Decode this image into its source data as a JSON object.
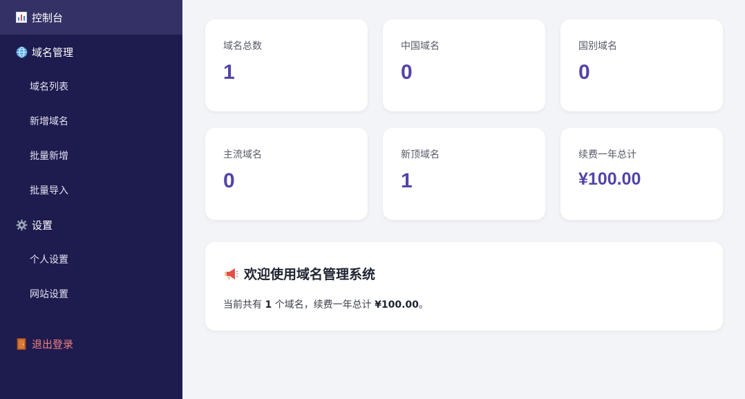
{
  "sidebar": {
    "items": [
      {
        "label": "控制台",
        "icon": "bar-chart-icon",
        "active": true
      },
      {
        "label": "域名管理",
        "icon": "globe-icon"
      },
      {
        "label": "域名列表",
        "sub": true
      },
      {
        "label": "新增域名",
        "sub": true
      },
      {
        "label": "批量新增",
        "sub": true
      },
      {
        "label": "批量导入",
        "sub": true
      },
      {
        "label": "设置",
        "icon": "gear-icon"
      },
      {
        "label": "个人设置",
        "sub": true
      },
      {
        "label": "网站设置",
        "sub": true
      }
    ],
    "logout_label": "退出登录",
    "logout_icon": "door-icon"
  },
  "stats": [
    {
      "label": "域名总数",
      "value": "1"
    },
    {
      "label": "中国域名",
      "value": "0"
    },
    {
      "label": "国别域名",
      "value": "0"
    },
    {
      "label": "主流域名",
      "value": "0"
    },
    {
      "label": "新顶域名",
      "value": "1"
    },
    {
      "label": "续费一年总计",
      "value": "¥100.00"
    }
  ],
  "welcome": {
    "icon": "megaphone-icon",
    "title": "欢迎使用域名管理系统",
    "desc_prefix": "当前共有",
    "count": "1",
    "desc_mid": "个域名，续费一年总计",
    "total": "¥100.00",
    "desc_suffix": "。"
  },
  "colors": {
    "sidebar_bg": "#1e1b4f",
    "sidebar_active": "#343166",
    "accent": "#5244a8",
    "logout": "#f08080"
  }
}
